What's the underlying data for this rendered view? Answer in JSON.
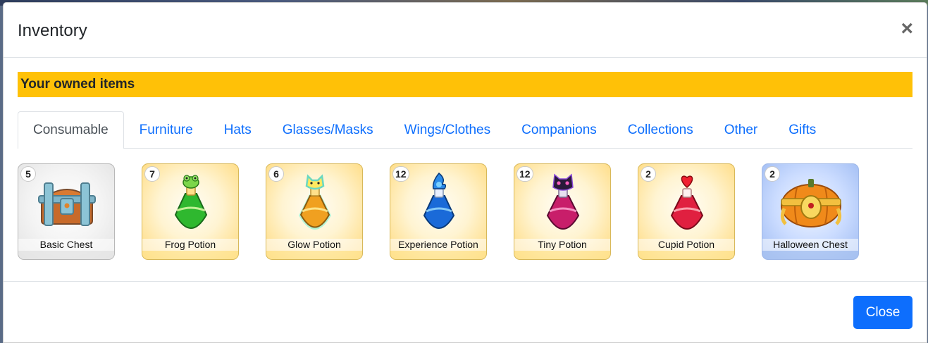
{
  "modal": {
    "title": "Inventory",
    "close_symbol": "×"
  },
  "banner": {
    "text": "Your owned items"
  },
  "tabs": [
    {
      "label": "Consumable",
      "active": true
    },
    {
      "label": "Furniture",
      "active": false
    },
    {
      "label": "Hats",
      "active": false
    },
    {
      "label": "Glasses/Masks",
      "active": false
    },
    {
      "label": "Wings/Clothes",
      "active": false
    },
    {
      "label": "Companions",
      "active": false
    },
    {
      "label": "Collections",
      "active": false
    },
    {
      "label": "Other",
      "active": false
    },
    {
      "label": "Gifts",
      "active": false
    }
  ],
  "items": [
    {
      "name": "Basic Chest",
      "count": "5",
      "icon": "chest-icon"
    },
    {
      "name": "Frog Potion",
      "count": "7",
      "icon": "frog-potion-icon",
      "color": "#2fb82f"
    },
    {
      "name": "Glow Potion",
      "count": "6",
      "icon": "glow-potion-icon",
      "color": "#f0a020"
    },
    {
      "name": "Experience Potion",
      "count": "12",
      "icon": "experience-potion-icon",
      "color": "#1a6ad8"
    },
    {
      "name": "Tiny Potion",
      "count": "12",
      "icon": "tiny-potion-icon",
      "color": "#c81e6a"
    },
    {
      "name": "Cupid Potion",
      "count": "2",
      "icon": "cupid-potion-icon",
      "color": "#e02040"
    },
    {
      "name": "Halloween Chest",
      "count": "2",
      "icon": "pumpkin-chest-icon"
    }
  ],
  "footer": {
    "close_label": "Close"
  },
  "colors": {
    "banner": "#ffc107",
    "primary": "#0d6efd"
  }
}
